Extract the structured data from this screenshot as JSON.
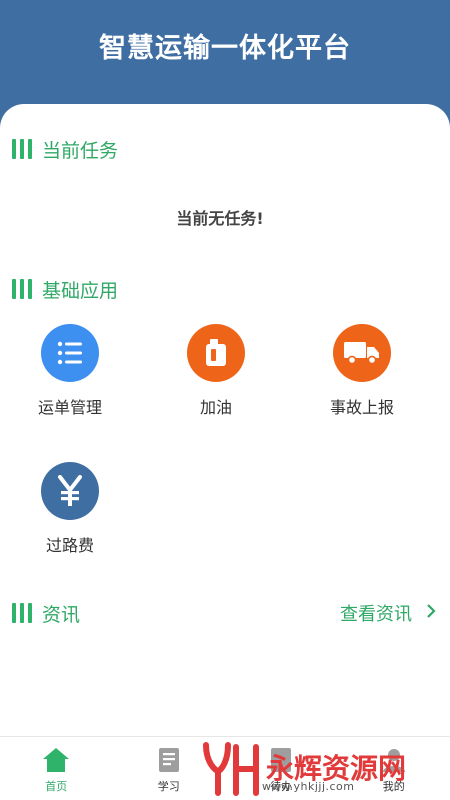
{
  "header": {
    "title": "智慧运输一体化平台"
  },
  "current_task": {
    "title": "当前任务",
    "empty_text": "当前无任务!"
  },
  "basic_apps": {
    "title": "基础应用",
    "items": [
      {
        "label": "运单管理",
        "icon": "list-icon",
        "color": "#3d8ff0"
      },
      {
        "label": "加油",
        "icon": "fuel-can-icon",
        "color": "#ee6418"
      },
      {
        "label": "事故上报",
        "icon": "truck-icon",
        "color": "#ee6418"
      },
      {
        "label": "过路费",
        "icon": "yen-icon",
        "color": "#3f6ea3"
      }
    ]
  },
  "news": {
    "title": "资讯",
    "link_label": "查看资讯",
    "link_icon": "chevron-right-icon"
  },
  "tabbar": {
    "items": [
      {
        "label": "首页",
        "icon": "home-icon",
        "active": true
      },
      {
        "label": "学习",
        "icon": "book-icon",
        "active": false
      },
      {
        "label": "待办",
        "icon": "todo-icon",
        "active": false
      },
      {
        "label": "我的",
        "icon": "user-icon",
        "active": false
      }
    ]
  },
  "watermark": {
    "text": "永辉资源网",
    "url": "www.yhkjjj.com"
  },
  "colors": {
    "header": "#3f6ea3",
    "accent": "#2fa866",
    "orange": "#ee6418",
    "blue": "#3d8ff0"
  }
}
